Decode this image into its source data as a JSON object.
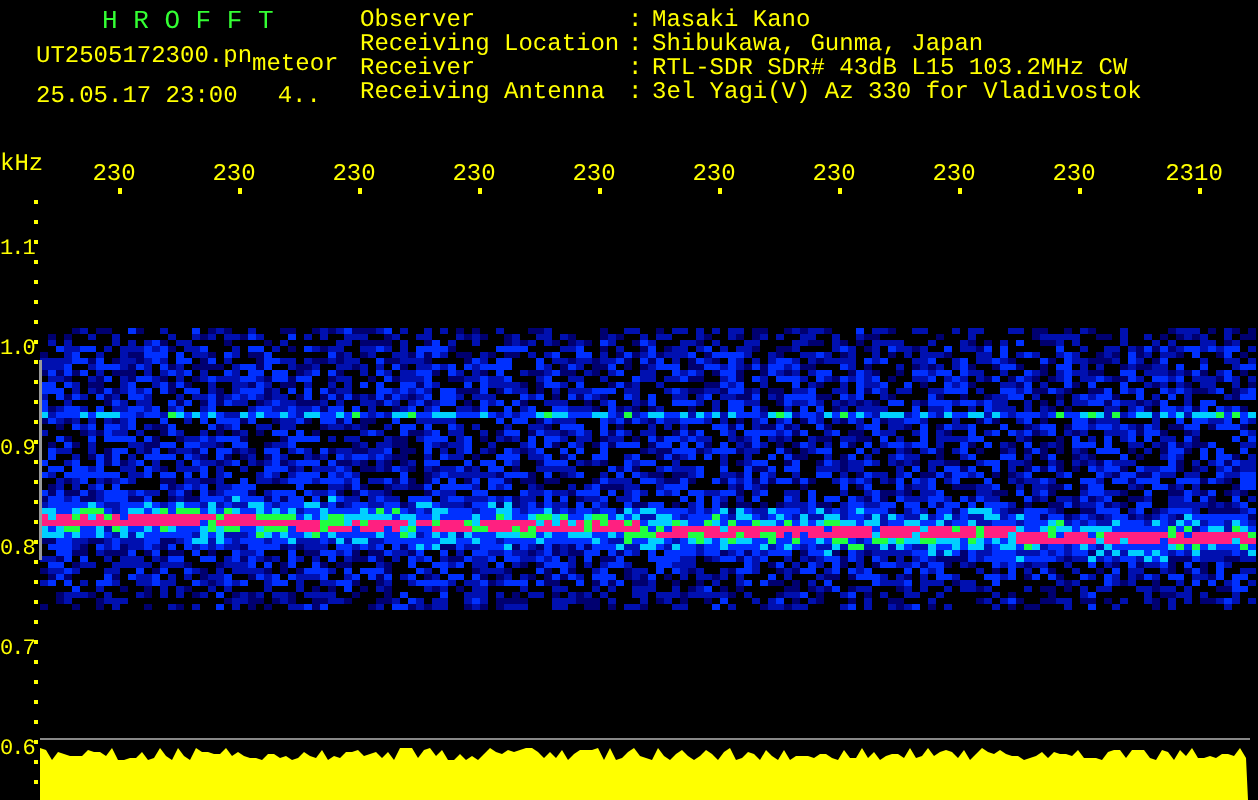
{
  "title": "H R O F F T",
  "file_name": "UT2505172300.pn",
  "file_tag": "meteor",
  "datetime": "25.05.17 23:00",
  "count": "4..",
  "info": [
    {
      "label": "Observer",
      "separator": ":",
      "value": "Masaki Kano"
    },
    {
      "label": "Receiving Location",
      "separator": ":",
      "value": "Shibukawa, Gunma, Japan"
    },
    {
      "label": "Receiver",
      "separator": ":",
      "value": "RTL-SDR SDR# 43dB L15 103.2MHz CW"
    },
    {
      "label": "Receiving Antenna",
      "separator": ":",
      "value": "3el Yagi(V) Az 330 for Vladivostok"
    }
  ],
  "unit": "kHz",
  "time_labels": [
    "230",
    "230",
    "230",
    "230",
    "230",
    "230",
    "230",
    "230",
    "230",
    "2310"
  ],
  "freq_labels": [
    "1.1",
    "1.0",
    "0.9",
    "0.8",
    "0.7",
    "0.6"
  ]
}
